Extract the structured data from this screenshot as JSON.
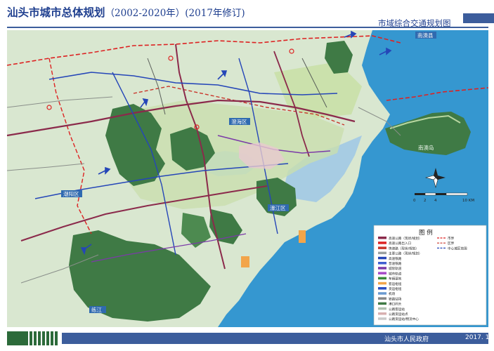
{
  "header": {
    "title_main": "汕头市城市总体规划",
    "title_period": "（2002-2020年）(2017年修订)",
    "subtitle": "市域综合交通规划图"
  },
  "legend": {
    "title": "图  例",
    "items_left": [
      "高速公路（现状/规划）",
      "高速公路出入口",
      "快速路（现状/规划）",
      "主要公路（现状/规划）",
      "高速铁路",
      "普速铁路",
      "城际轨道",
      "城市轨道",
      "车辆基地",
      "客运枢纽",
      "货运枢纽",
      "机场",
      "铁路站场",
      "港口码头",
      "公路客运站",
      "公路货运站点",
      "公路货运站/物流中心"
    ],
    "items_right": [
      "市界",
      "区界",
      "中心城区范围"
    ]
  },
  "scale_bar": {
    "ticks": [
      "0",
      "2",
      "4",
      "10 KM"
    ]
  },
  "map_labels": [
    "潮阳区",
    "濠江区",
    "澄海区",
    "南澳县",
    "练江",
    "南澳岛"
  ],
  "footer": {
    "issuer": "汕头市人民政府",
    "date": "2017. 1"
  },
  "colors": {
    "title_blue": "#1f3f8f",
    "band_blue": "#3c5d9c",
    "forest": "#3f7a45",
    "sea": "#2f8fc8",
    "land": "#dbe8d2"
  }
}
